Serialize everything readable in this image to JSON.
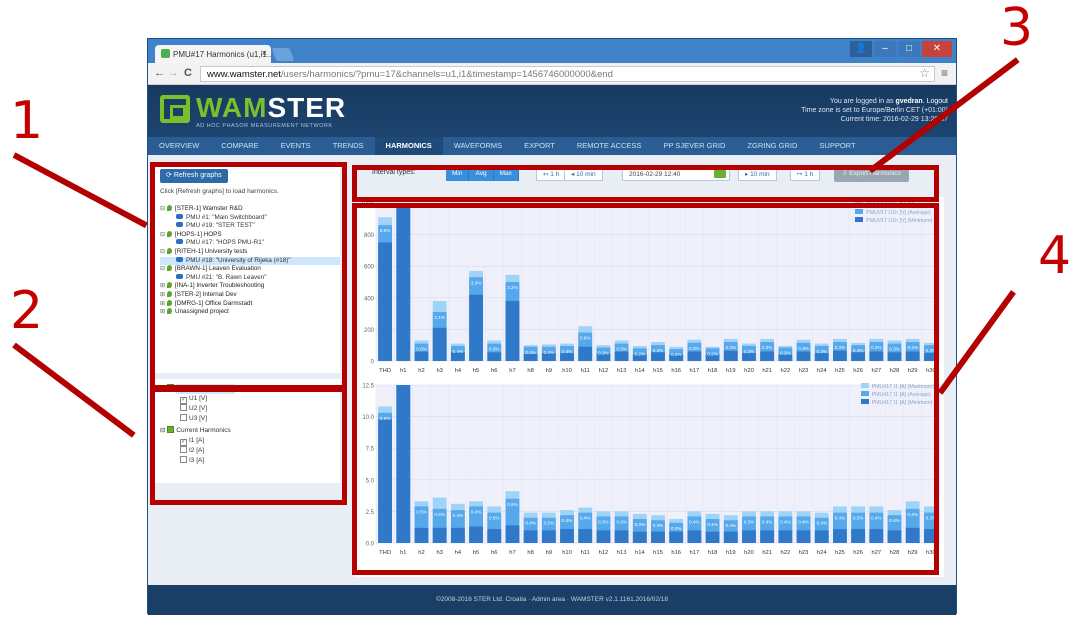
{
  "callouts": {
    "one": "1",
    "two": "2",
    "three": "3",
    "four": "4"
  },
  "browser": {
    "tab_title": "PMU#17 Harmonics (u1,i1...",
    "tab_close": "×",
    "url_host": "www.wamster.net",
    "url_rest": "/users/harmonics/?pmu=17&channels=u1,i1&timestamp=1456746000000&end",
    "back": "←",
    "forward": "→",
    "reload": "C",
    "star": "☆",
    "menu": "≡",
    "btn_user": "👤",
    "btn_min": "–",
    "btn_max": "□",
    "btn_close": "✕"
  },
  "brand": {
    "name_prefix": "WAM",
    "name_suffix": "STER",
    "tagline": "AD HOC PHASOR MEASUREMENT NETWORK",
    "logo_color": "#7bbf2a"
  },
  "login": {
    "line1_prefix": "You are logged in as",
    "user": "gvedran",
    "logout": "Logout",
    "line2": "Time zone is set to Europe/Berlin CET (+01:00)",
    "line3": "Current time: 2016-02-29 13:20:57"
  },
  "nav": [
    "OVERVIEW",
    "COMPARE",
    "EVENTS",
    "TRENDS",
    "HARMONICS",
    "WAVEFORMS",
    "EXPORT",
    "REMOTE ACCESS",
    "PP SJEVER GRID",
    "ZGRING GRID",
    "SUPPORT"
  ],
  "nav_active": "HARMONICS",
  "left": {
    "refresh_label": "Refresh graphs",
    "refresh_icon": "⟳",
    "hint": "Click [Refresh graphs] to load harmonics.",
    "tree": [
      {
        "type": "project",
        "exp": "⊟",
        "label": "[STER-1] Wamster R&D"
      },
      {
        "type": "pmu",
        "label": "PMU #1: \"Main Switchboard\""
      },
      {
        "type": "pmu",
        "label": "PMU #19: \"STER TEST\""
      },
      {
        "type": "project",
        "exp": "⊟",
        "label": "[HOPS-1] HOPS"
      },
      {
        "type": "pmu",
        "label": "PMU #17: \"HOPS PMU-R1\""
      },
      {
        "type": "project",
        "exp": "⊟",
        "label": "[RITEH-1] University tests"
      },
      {
        "type": "pmu",
        "label": "PMU #18: \"University of Rijeka (#18)\"",
        "selected": true
      },
      {
        "type": "project",
        "exp": "⊟",
        "label": "[BRAWN-1] Leaven Evaluation"
      },
      {
        "type": "pmu",
        "label": "PMU #21: \"B. Rawn Leaven\""
      },
      {
        "type": "project",
        "exp": "⊞",
        "label": "[INA-1] Inverter Troubleshooting"
      },
      {
        "type": "project",
        "exp": "⊞",
        "label": "[STER-2] Internal Dev"
      },
      {
        "type": "project",
        "exp": "⊞",
        "label": "[DMRG-1] Office Darmstadt"
      },
      {
        "type": "project",
        "exp": "⊞",
        "label": "Unassigned project"
      }
    ],
    "channels": {
      "voltage_group": "Voltage Harmonics",
      "voltage_items": [
        {
          "label": "U1 [V]",
          "checked": true
        },
        {
          "label": "U2 [V]",
          "checked": false
        },
        {
          "label": "U3 [V]",
          "checked": false
        }
      ],
      "current_group": "Current Harmonics",
      "current_items": [
        {
          "label": "I1 [A]",
          "checked": true
        },
        {
          "label": "I2 [A]",
          "checked": false
        },
        {
          "label": "I3 [A]",
          "checked": false
        }
      ],
      "check_mark": "✓",
      "expander": "⊟"
    }
  },
  "toolbar": {
    "interval_label": "Interval types:",
    "interval_types": [
      "Min",
      "Avg",
      "Max"
    ],
    "back_1h": "↤ 1 h",
    "back_10min": "◂ 10 min",
    "date": "2016-02-29 12:40",
    "fwd_10min": "▸ 10 min",
    "fwd_1h": "↦ 1 h",
    "export_label": "Export Harmonics",
    "export_icon": "⇩"
  },
  "colors": {
    "max": "#9fd3f7",
    "avg": "#56a8ec",
    "min": "#2f79c8",
    "annotation_red": "#b40000",
    "plot_bg": "#f0f0fb"
  },
  "chart_data": [
    {
      "type": "bar",
      "categories": [
        "THD",
        "h1",
        "h2",
        "h3",
        "h4",
        "h5",
        "h6",
        "h7",
        "h8",
        "h9",
        "h10",
        "h11",
        "h12",
        "h13",
        "h14",
        "h15",
        "h16",
        "h17",
        "h18",
        "h19",
        "h20",
        "h21",
        "h22",
        "h23",
        "h24",
        "h25",
        "h26",
        "h27",
        "h28",
        "h29",
        "h30"
      ],
      "ylim": [
        0,
        1000
      ],
      "yticks": [
        "0",
        "200",
        "400",
        "600",
        "800",
        "1000"
      ],
      "series": [
        {
          "name": "PMU#17 U1h [V] (Maximum)",
          "values": [
            910,
            1000,
            130,
            380,
            110,
            570,
            130,
            545,
            100,
            105,
            110,
            220,
            100,
            130,
            95,
            120,
            90,
            135,
            90,
            140,
            110,
            140,
            95,
            135,
            110,
            140,
            115,
            140,
            130,
            140,
            115
          ]
        },
        {
          "name": "PMU#17 U1h [V] (Average)",
          "values": [
            860,
            1000,
            110,
            310,
            95,
            530,
            110,
            500,
            90,
            90,
            95,
            180,
            85,
            110,
            80,
            100,
            75,
            115,
            80,
            120,
            95,
            120,
            85,
            115,
            95,
            120,
            100,
            120,
            110,
            120,
            100
          ]
        },
        {
          "name": "PMU#17 U1h [V] (Minimum)",
          "values": [
            750,
            1000,
            60,
            210,
            55,
            420,
            55,
            380,
            45,
            50,
            50,
            90,
            45,
            60,
            40,
            55,
            40,
            60,
            40,
            65,
            50,
            60,
            40,
            60,
            50,
            65,
            55,
            60,
            55,
            60,
            50
          ]
        }
      ],
      "labels": [
        "8.8%",
        "",
        "0.5%",
        "2.1%",
        "0.4%",
        "3.3%",
        "0.3%",
        "3.2%",
        "0.4%",
        "0.4%",
        "0.4%",
        "0.9%",
        "0.2%",
        "0.3%",
        "0.2%",
        "0.2%",
        "0.2%",
        "0.3%",
        "0.2%",
        "0.3%",
        "0.3%",
        "0.3%",
        "0.2%",
        "0.3%",
        "0.3%",
        "0.3%",
        "0.3%",
        "0.3%",
        "0.3%",
        "0.4%",
        "0.3%"
      ]
    },
    {
      "type": "bar",
      "categories": [
        "THD",
        "h1",
        "h2",
        "h3",
        "h4",
        "h5",
        "h6",
        "h7",
        "h8",
        "h9",
        "h10",
        "h11",
        "h12",
        "h13",
        "h14",
        "h15",
        "h16",
        "h17",
        "h18",
        "h19",
        "h20",
        "h21",
        "h22",
        "h23",
        "h24",
        "h25",
        "h26",
        "h27",
        "h28",
        "h29",
        "h30"
      ],
      "ylim": [
        0,
        12.5
      ],
      "yticks": [
        "0.0",
        "2.5",
        "5.0",
        "7.5",
        "10.0",
        "12.5"
      ],
      "series": [
        {
          "name": "PMU#17 I1 [A] (Maximum)",
          "values": [
            10.8,
            12.5,
            3.3,
            3.6,
            3.1,
            3.3,
            2.9,
            4.1,
            2.4,
            2.4,
            2.6,
            2.8,
            2.5,
            2.5,
            2.3,
            2.2,
            1.9,
            2.5,
            2.3,
            2.2,
            2.5,
            2.5,
            2.5,
            2.5,
            2.4,
            2.9,
            2.9,
            2.9,
            2.6,
            3.3,
            2.9
          ]
        },
        {
          "name": "PMU#17 I1 [A] (Average)",
          "values": [
            10.3,
            12.5,
            2.9,
            2.7,
            2.6,
            2.9,
            2.4,
            3.5,
            2.0,
            2.0,
            2.2,
            2.4,
            2.1,
            2.1,
            1.9,
            1.8,
            1.6,
            2.1,
            1.9,
            1.8,
            2.1,
            2.1,
            2.1,
            2.1,
            2.0,
            2.4,
            2.4,
            2.4,
            2.2,
            2.7,
            2.4
          ]
        },
        {
          "name": "PMU#17 I1 [A] (Minimum)",
          "values": [
            9.8,
            12.5,
            1.2,
            1.2,
            1.2,
            1.3,
            1.1,
            1.4,
            1.0,
            1.0,
            1.1,
            1.1,
            1.0,
            1.0,
            0.9,
            0.9,
            0.9,
            1.0,
            0.9,
            0.9,
            1.0,
            1.0,
            1.0,
            1.0,
            1.0,
            1.1,
            1.1,
            1.1,
            1.0,
            1.2,
            1.1
          ]
        }
      ],
      "labels": [
        "8.8%",
        "",
        "0.5%",
        "0.5%",
        "0.4%",
        "0.4%",
        "0.5%",
        "0.6%",
        "0.4%",
        "0.5%",
        "0.4%",
        "0.4%",
        "0.3%",
        "0.3%",
        "0.3%",
        "0.3%",
        "0.3%",
        "0.4%",
        "0.4%",
        "0.4%",
        "0.3%",
        "0.4%",
        "0.4%",
        "0.4%",
        "0.4%",
        "0.4%",
        "0.5%",
        "0.4%",
        "0.4%",
        "0.4%",
        "0.3%"
      ]
    }
  ],
  "footer": "©2008-2016 STER Ltd. Croatia · Admin area · WAMSTER v2.1.1161.2016/02/18"
}
